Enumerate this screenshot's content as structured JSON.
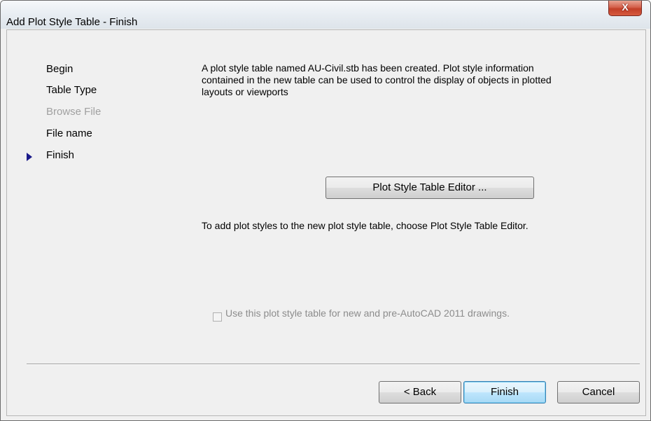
{
  "window": {
    "title": "Add Plot Style Table - Finish",
    "close_glyph": "X"
  },
  "nav": {
    "items": [
      {
        "label": "Begin",
        "state": "normal"
      },
      {
        "label": "Table Type",
        "state": "normal"
      },
      {
        "label": "Browse File",
        "state": "disabled"
      },
      {
        "label": "File name",
        "state": "normal"
      },
      {
        "label": "Finish",
        "state": "current"
      }
    ]
  },
  "main": {
    "message": "A plot style table named AU-Civil.stb has been created. Plot style information contained in the new table can be used to control the display of objects in plotted layouts or viewports",
    "editor_button_label": "Plot Style Table Editor ...",
    "instruction": "To add plot styles to the new plot style table, choose Plot Style Table Editor.",
    "checkbox": {
      "label": "Use this plot style table for new and pre-AutoCAD 2011 drawings.",
      "checked": false,
      "enabled": false
    }
  },
  "footer": {
    "back_label": "< Back",
    "finish_label": "Finish",
    "cancel_label": "Cancel"
  },
  "colors": {
    "nav_arrow": "#1a1a8a",
    "disabled_text": "#a0a0a0",
    "close_button": "#c23f28"
  }
}
